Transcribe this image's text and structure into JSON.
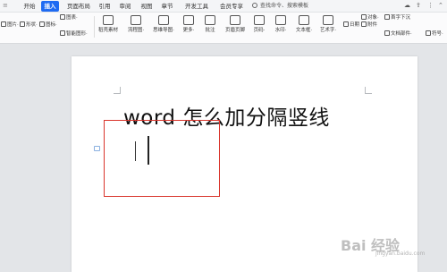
{
  "tabs": [
    {
      "label": "开始"
    },
    {
      "label": "插入",
      "active": true
    },
    {
      "label": "页面布局"
    },
    {
      "label": "引用"
    },
    {
      "label": "审阅"
    },
    {
      "label": "视图"
    },
    {
      "label": "章节"
    },
    {
      "label": "开发工具"
    },
    {
      "label": "会员专享"
    }
  ],
  "search": {
    "label": "查找命令、搜索模板"
  },
  "toolbar": {
    "left_items": [
      {
        "label": "图片·",
        "icon": "image-icon"
      },
      {
        "label": "形状·",
        "icon": "shape-icon"
      },
      {
        "label": "图标·",
        "icon": "icon-library-icon"
      },
      {
        "label": "图表·",
        "icon": "chart-icon"
      },
      {
        "label": "智能图形·",
        "icon": "smartart-icon"
      }
    ],
    "big_items": [
      {
        "label": "稻壳素材",
        "icon": "docer-icon"
      },
      {
        "label": "流程图·",
        "icon": "flowchart-icon"
      },
      {
        "label": "思维导图·",
        "icon": "mindmap-icon"
      },
      {
        "label": "更多·",
        "icon": "more-icon"
      },
      {
        "label": "批注",
        "icon": "comment-icon"
      },
      {
        "label": "页眉页脚",
        "icon": "header-footer-icon"
      },
      {
        "label": "页码·",
        "icon": "page-number-icon"
      },
      {
        "label": "水印·",
        "icon": "watermark-icon"
      },
      {
        "label": "文本框·",
        "icon": "textbox-icon"
      },
      {
        "label": "艺术字·",
        "icon": "wordart-icon"
      }
    ],
    "right_items": [
      {
        "label": "日期",
        "icon": "date-icon"
      },
      {
        "label": "附件",
        "icon": "attachment-icon"
      },
      {
        "label": "对象·",
        "icon": "object-icon"
      },
      {
        "label": "首字下沉",
        "icon": "dropcap-icon"
      },
      {
        "label": "文档部件·",
        "icon": "doc-parts-icon"
      },
      {
        "label": "符号·",
        "icon": "symbol-icon"
      }
    ]
  },
  "document": {
    "title": "word 怎么加分隔竖线"
  },
  "annotation": {
    "color": "#d9342b"
  },
  "accent": "#1f6bf2",
  "watermark": {
    "brand": "Bai  经验",
    "sub": "jingyan.baidu.com"
  }
}
